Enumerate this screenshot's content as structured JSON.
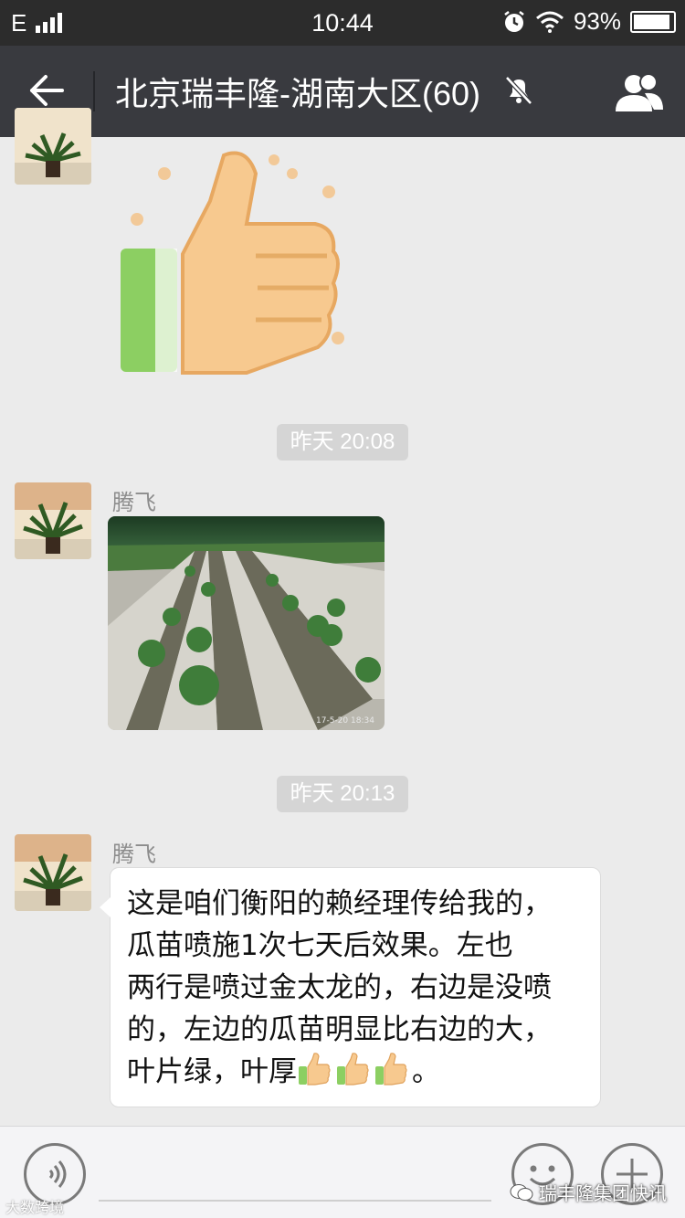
{
  "status_bar": {
    "carrier": "E",
    "time": "10:44",
    "battery": "93%",
    "battery_level": 0.93
  },
  "header": {
    "title": "北京瑞丰隆-湖南大区(60)"
  },
  "messages": [
    {
      "type": "sticker",
      "sticker_icon": "thumbs-up-icon"
    },
    {
      "type": "timestamp",
      "text": "昨天 20:08"
    },
    {
      "type": "image",
      "sender": "腾飞",
      "photo_stamp": "17-5-20 18:34"
    },
    {
      "type": "timestamp",
      "text": "昨天 20:13"
    },
    {
      "type": "text",
      "sender": "腾飞",
      "lines": [
        "这是咱们衡阳的赖经理传给我的，",
        "  瓜苗喷施1次七天后效果。左也",
        "两行是喷过金太龙的，右边是没喷",
        "的，左边的瓜苗明显比右边的大，",
        "叶片绿，叶厚"
      ],
      "trailing_emoji": "thumbs-up-icon",
      "emoji_count": 3,
      "end_punct": "。"
    }
  ],
  "watermark": {
    "left": "大数跨境",
    "right": "瑞丰隆集团快讯"
  },
  "colors": {
    "header_bg": "#393a3f",
    "status_bg": "#2c2c2c",
    "chat_bg": "#ebebeb",
    "timestamp_bg": "#d5d5d5"
  }
}
